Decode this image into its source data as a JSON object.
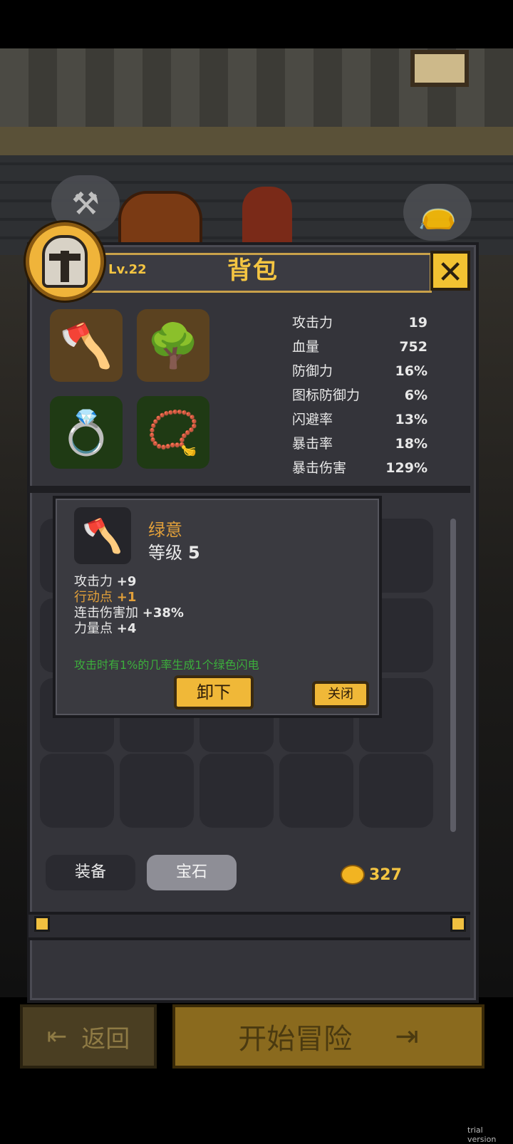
{
  "header": {
    "title": "背包",
    "level": "Lv.22"
  },
  "close_icon": "close-x-icon",
  "equipment_slots": [
    {
      "icon": "axe-icon",
      "glyph": "🪓"
    },
    {
      "icon": "bush-armor-icon",
      "glyph": "🌳"
    },
    {
      "icon": "ring-icon",
      "glyph": "💍"
    },
    {
      "icon": "necklace-icon",
      "glyph": "📿"
    }
  ],
  "stats": [
    {
      "label": "攻击力",
      "value": "19"
    },
    {
      "label": "血量",
      "value": "752"
    },
    {
      "label": "防御力",
      "value": "16%"
    },
    {
      "label": "图标防御力",
      "value": "6%"
    },
    {
      "label": "闪避率",
      "value": "13%"
    },
    {
      "label": "暴击率",
      "value": "18%"
    },
    {
      "label": "暴击伤害",
      "value": "129%"
    }
  ],
  "tooltip": {
    "name": "绿意",
    "level_label": "等级",
    "level_value": "5",
    "lines": [
      {
        "label": "攻击力",
        "value": "+9"
      },
      {
        "label": "行动点",
        "value": "+1"
      },
      {
        "label": "连击伤害加",
        "value": "+38%"
      },
      {
        "label": "力量点",
        "value": "+4"
      }
    ],
    "description": "攻击时有1%的几率生成1个绿色闪电",
    "unequip_label": "卸下",
    "close_label": "关闭"
  },
  "tabs": [
    {
      "label": "装备"
    },
    {
      "label": "宝石"
    }
  ],
  "gold": "327",
  "footer": {
    "back_label": "返回",
    "start_label": "开始冒险"
  },
  "watermark": "trial version"
}
